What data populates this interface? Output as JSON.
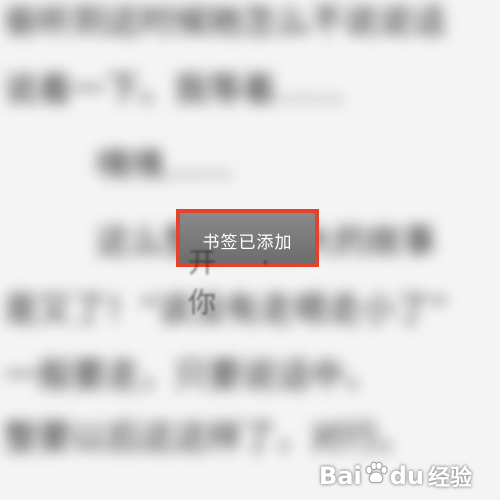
{
  "toast": {
    "message": "书签已添加",
    "ghost_background": "开 · 你"
  },
  "background_text": {
    "lines": [
      "偷听到这时候她怎么不说说话",
      "说着一下。我等着……",
      "咦咦……",
      "这么整着手也大的故事",
      "是又了！“该没有走嗯走小了”",
      "一般要走，只要说话中，",
      "整要以后这这样了，对行。"
    ]
  },
  "watermark": {
    "brand_left": "Bai",
    "brand_right": "du",
    "product": "经验"
  },
  "colors": {
    "highlight_border": "#e2432a",
    "toast_background": "#7a7a7a",
    "page_background": "#f4f4f4"
  }
}
